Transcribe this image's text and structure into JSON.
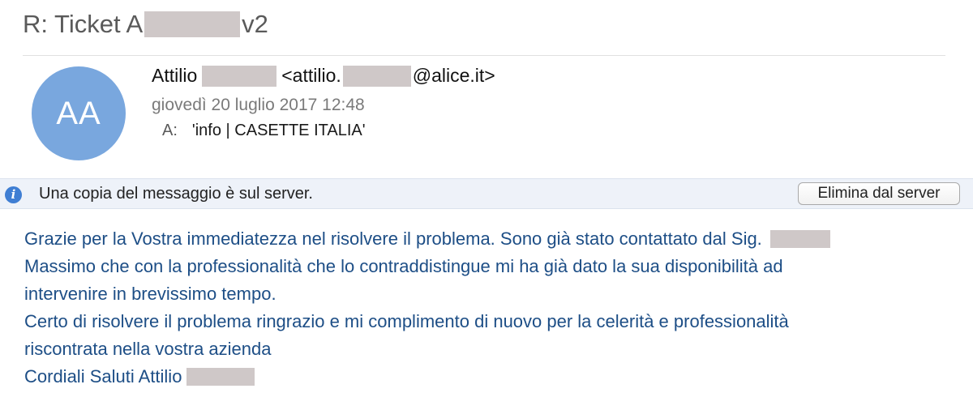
{
  "email": {
    "subject_prefix": "R: Ticket A",
    "subject_suffix": "v2",
    "avatar_initials": "AA",
    "from_name": "Attilio",
    "from_email_prefix": "<attilio.",
    "from_email_suffix": "@alice.it>",
    "date": "giovedì 20 luglio 2017 12:48",
    "to_label": "A:",
    "to_value": "'info | CASETTE ITALIA'"
  },
  "info_bar": {
    "icon": "info-icon",
    "message": "Una copia del messaggio è sul server.",
    "button_label": "Elimina dal server"
  },
  "body": {
    "line1": "Grazie per la Vostra immediatezza nel risolvere il problema. Sono già stato contattato dal Sig.",
    "line2": "Massimo che con la professionalità che lo contraddistingue mi ha già dato la sua disponibilità ad",
    "line3": "intervenire in brevissimo tempo.",
    "line4": "Certo di risolvere il problema ringrazio e mi complimento di nuovo per la celerità e professionalità",
    "line5": "riscontrata nella vostra azienda",
    "line6": "Cordiali Saluti Attilio"
  },
  "colors": {
    "avatar": "#79a7de",
    "body_text": "#1d4e86",
    "info_bar_bg": "#eef2f9",
    "info_icon": "#3f7ed3",
    "redaction": "#cfc8c8"
  }
}
